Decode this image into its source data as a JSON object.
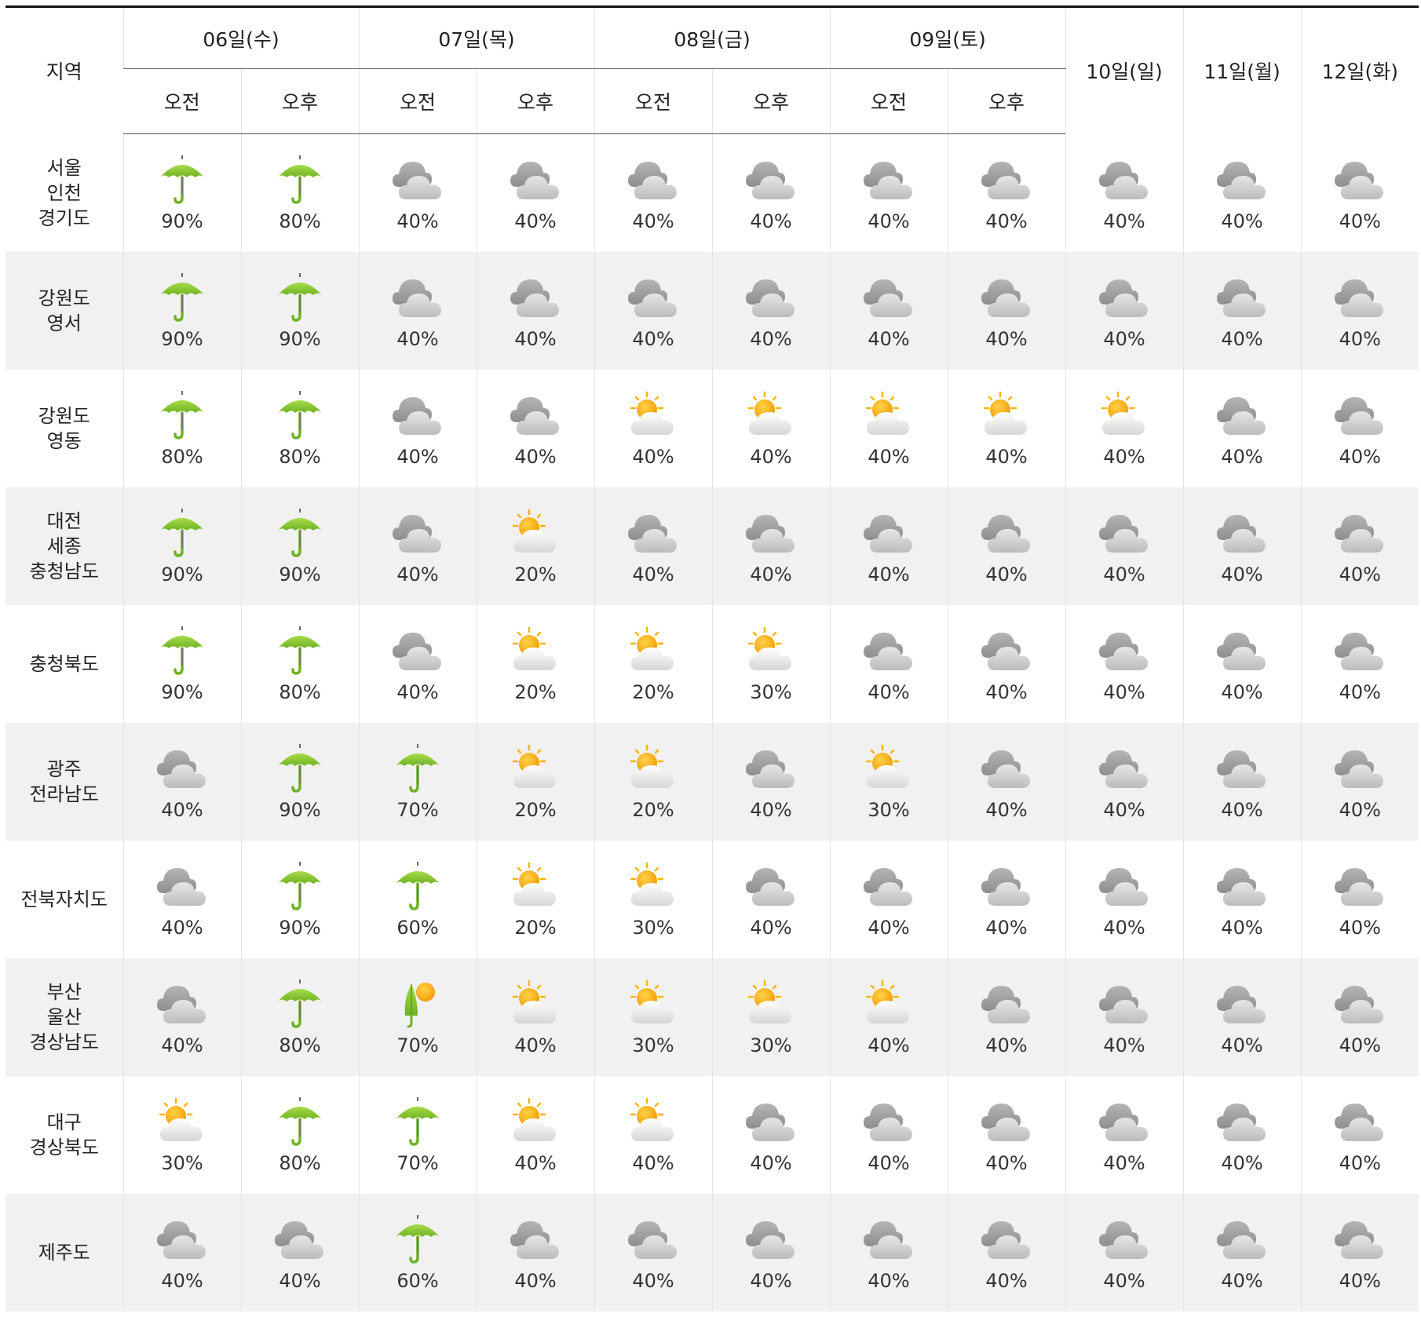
{
  "header": {
    "region_label": "지역",
    "days": [
      {
        "label": "06일(수)",
        "split": true
      },
      {
        "label": "07일(목)",
        "split": true
      },
      {
        "label": "08일(금)",
        "split": true
      },
      {
        "label": "09일(토)",
        "split": true
      },
      {
        "label": "10일(일)",
        "split": false
      },
      {
        "label": "11일(월)",
        "split": false
      },
      {
        "label": "12일(화)",
        "split": false
      }
    ],
    "am_label": "오전",
    "pm_label": "오후"
  },
  "icon_types": {
    "umbrella": "umbrella-icon (rain)",
    "cloud": "cloud-icon (cloudy)",
    "partly": "sun-cloud-icon (partly cloudy)",
    "shower": "sun-umbrella-icon (shower)"
  },
  "colors": {
    "umbrella": "#8cc63f",
    "sun": "#f7b500",
    "cloud": "#a9a9a9"
  },
  "rows": [
    {
      "region": [
        "서울",
        "인천",
        "경기도"
      ],
      "cells": [
        {
          "icon": "umbrella",
          "prob": "90%"
        },
        {
          "icon": "umbrella",
          "prob": "80%"
        },
        {
          "icon": "cloud",
          "prob": "40%"
        },
        {
          "icon": "cloud",
          "prob": "40%"
        },
        {
          "icon": "cloud",
          "prob": "40%"
        },
        {
          "icon": "cloud",
          "prob": "40%"
        },
        {
          "icon": "cloud",
          "prob": "40%"
        },
        {
          "icon": "cloud",
          "prob": "40%"
        },
        {
          "icon": "cloud",
          "prob": "40%"
        },
        {
          "icon": "cloud",
          "prob": "40%"
        },
        {
          "icon": "cloud",
          "prob": "40%"
        }
      ]
    },
    {
      "region": [
        "강원도",
        "영서"
      ],
      "cells": [
        {
          "icon": "umbrella",
          "prob": "90%"
        },
        {
          "icon": "umbrella",
          "prob": "90%"
        },
        {
          "icon": "cloud",
          "prob": "40%"
        },
        {
          "icon": "cloud",
          "prob": "40%"
        },
        {
          "icon": "cloud",
          "prob": "40%"
        },
        {
          "icon": "cloud",
          "prob": "40%"
        },
        {
          "icon": "cloud",
          "prob": "40%"
        },
        {
          "icon": "cloud",
          "prob": "40%"
        },
        {
          "icon": "cloud",
          "prob": "40%"
        },
        {
          "icon": "cloud",
          "prob": "40%"
        },
        {
          "icon": "cloud",
          "prob": "40%"
        }
      ]
    },
    {
      "region": [
        "강원도",
        "영동"
      ],
      "cells": [
        {
          "icon": "umbrella",
          "prob": "80%"
        },
        {
          "icon": "umbrella",
          "prob": "80%"
        },
        {
          "icon": "cloud",
          "prob": "40%"
        },
        {
          "icon": "cloud",
          "prob": "40%"
        },
        {
          "icon": "partly",
          "prob": "40%"
        },
        {
          "icon": "partly",
          "prob": "40%"
        },
        {
          "icon": "partly",
          "prob": "40%"
        },
        {
          "icon": "partly",
          "prob": "40%"
        },
        {
          "icon": "partly",
          "prob": "40%"
        },
        {
          "icon": "cloud",
          "prob": "40%"
        },
        {
          "icon": "cloud",
          "prob": "40%"
        }
      ]
    },
    {
      "region": [
        "대전",
        "세종",
        "충청남도"
      ],
      "cells": [
        {
          "icon": "umbrella",
          "prob": "90%"
        },
        {
          "icon": "umbrella",
          "prob": "90%"
        },
        {
          "icon": "cloud",
          "prob": "40%"
        },
        {
          "icon": "partly",
          "prob": "20%"
        },
        {
          "icon": "cloud",
          "prob": "40%"
        },
        {
          "icon": "cloud",
          "prob": "40%"
        },
        {
          "icon": "cloud",
          "prob": "40%"
        },
        {
          "icon": "cloud",
          "prob": "40%"
        },
        {
          "icon": "cloud",
          "prob": "40%"
        },
        {
          "icon": "cloud",
          "prob": "40%"
        },
        {
          "icon": "cloud",
          "prob": "40%"
        }
      ]
    },
    {
      "region": [
        "충청북도"
      ],
      "cells": [
        {
          "icon": "umbrella",
          "prob": "90%"
        },
        {
          "icon": "umbrella",
          "prob": "80%"
        },
        {
          "icon": "cloud",
          "prob": "40%"
        },
        {
          "icon": "partly",
          "prob": "20%"
        },
        {
          "icon": "partly",
          "prob": "20%"
        },
        {
          "icon": "partly",
          "prob": "30%"
        },
        {
          "icon": "cloud",
          "prob": "40%"
        },
        {
          "icon": "cloud",
          "prob": "40%"
        },
        {
          "icon": "cloud",
          "prob": "40%"
        },
        {
          "icon": "cloud",
          "prob": "40%"
        },
        {
          "icon": "cloud",
          "prob": "40%"
        }
      ]
    },
    {
      "region": [
        "광주",
        "전라남도"
      ],
      "cells": [
        {
          "icon": "cloud",
          "prob": "40%"
        },
        {
          "icon": "umbrella",
          "prob": "90%"
        },
        {
          "icon": "umbrella",
          "prob": "70%"
        },
        {
          "icon": "partly",
          "prob": "20%"
        },
        {
          "icon": "partly",
          "prob": "20%"
        },
        {
          "icon": "cloud",
          "prob": "40%"
        },
        {
          "icon": "partly",
          "prob": "30%"
        },
        {
          "icon": "cloud",
          "prob": "40%"
        },
        {
          "icon": "cloud",
          "prob": "40%"
        },
        {
          "icon": "cloud",
          "prob": "40%"
        },
        {
          "icon": "cloud",
          "prob": "40%"
        }
      ]
    },
    {
      "region": [
        "전북자치도"
      ],
      "cells": [
        {
          "icon": "cloud",
          "prob": "40%"
        },
        {
          "icon": "umbrella",
          "prob": "90%"
        },
        {
          "icon": "umbrella",
          "prob": "60%"
        },
        {
          "icon": "partly",
          "prob": "20%"
        },
        {
          "icon": "partly",
          "prob": "30%"
        },
        {
          "icon": "cloud",
          "prob": "40%"
        },
        {
          "icon": "cloud",
          "prob": "40%"
        },
        {
          "icon": "cloud",
          "prob": "40%"
        },
        {
          "icon": "cloud",
          "prob": "40%"
        },
        {
          "icon": "cloud",
          "prob": "40%"
        },
        {
          "icon": "cloud",
          "prob": "40%"
        }
      ]
    },
    {
      "region": [
        "부산",
        "울산",
        "경상남도"
      ],
      "cells": [
        {
          "icon": "cloud",
          "prob": "40%"
        },
        {
          "icon": "umbrella",
          "prob": "80%"
        },
        {
          "icon": "shower",
          "prob": "70%"
        },
        {
          "icon": "partly",
          "prob": "40%"
        },
        {
          "icon": "partly",
          "prob": "30%"
        },
        {
          "icon": "partly",
          "prob": "30%"
        },
        {
          "icon": "partly",
          "prob": "40%"
        },
        {
          "icon": "cloud",
          "prob": "40%"
        },
        {
          "icon": "cloud",
          "prob": "40%"
        },
        {
          "icon": "cloud",
          "prob": "40%"
        },
        {
          "icon": "cloud",
          "prob": "40%"
        }
      ]
    },
    {
      "region": [
        "대구",
        "경상북도"
      ],
      "cells": [
        {
          "icon": "partly",
          "prob": "30%"
        },
        {
          "icon": "umbrella",
          "prob": "80%"
        },
        {
          "icon": "umbrella",
          "prob": "70%"
        },
        {
          "icon": "partly",
          "prob": "40%"
        },
        {
          "icon": "partly",
          "prob": "40%"
        },
        {
          "icon": "cloud",
          "prob": "40%"
        },
        {
          "icon": "cloud",
          "prob": "40%"
        },
        {
          "icon": "cloud",
          "prob": "40%"
        },
        {
          "icon": "cloud",
          "prob": "40%"
        },
        {
          "icon": "cloud",
          "prob": "40%"
        },
        {
          "icon": "cloud",
          "prob": "40%"
        }
      ]
    },
    {
      "region": [
        "제주도"
      ],
      "cells": [
        {
          "icon": "cloud",
          "prob": "40%"
        },
        {
          "icon": "cloud",
          "prob": "40%"
        },
        {
          "icon": "umbrella",
          "prob": "60%"
        },
        {
          "icon": "cloud",
          "prob": "40%"
        },
        {
          "icon": "cloud",
          "prob": "40%"
        },
        {
          "icon": "cloud",
          "prob": "40%"
        },
        {
          "icon": "cloud",
          "prob": "40%"
        },
        {
          "icon": "cloud",
          "prob": "40%"
        },
        {
          "icon": "cloud",
          "prob": "40%"
        },
        {
          "icon": "cloud",
          "prob": "40%"
        },
        {
          "icon": "cloud",
          "prob": "40%"
        }
      ]
    }
  ]
}
